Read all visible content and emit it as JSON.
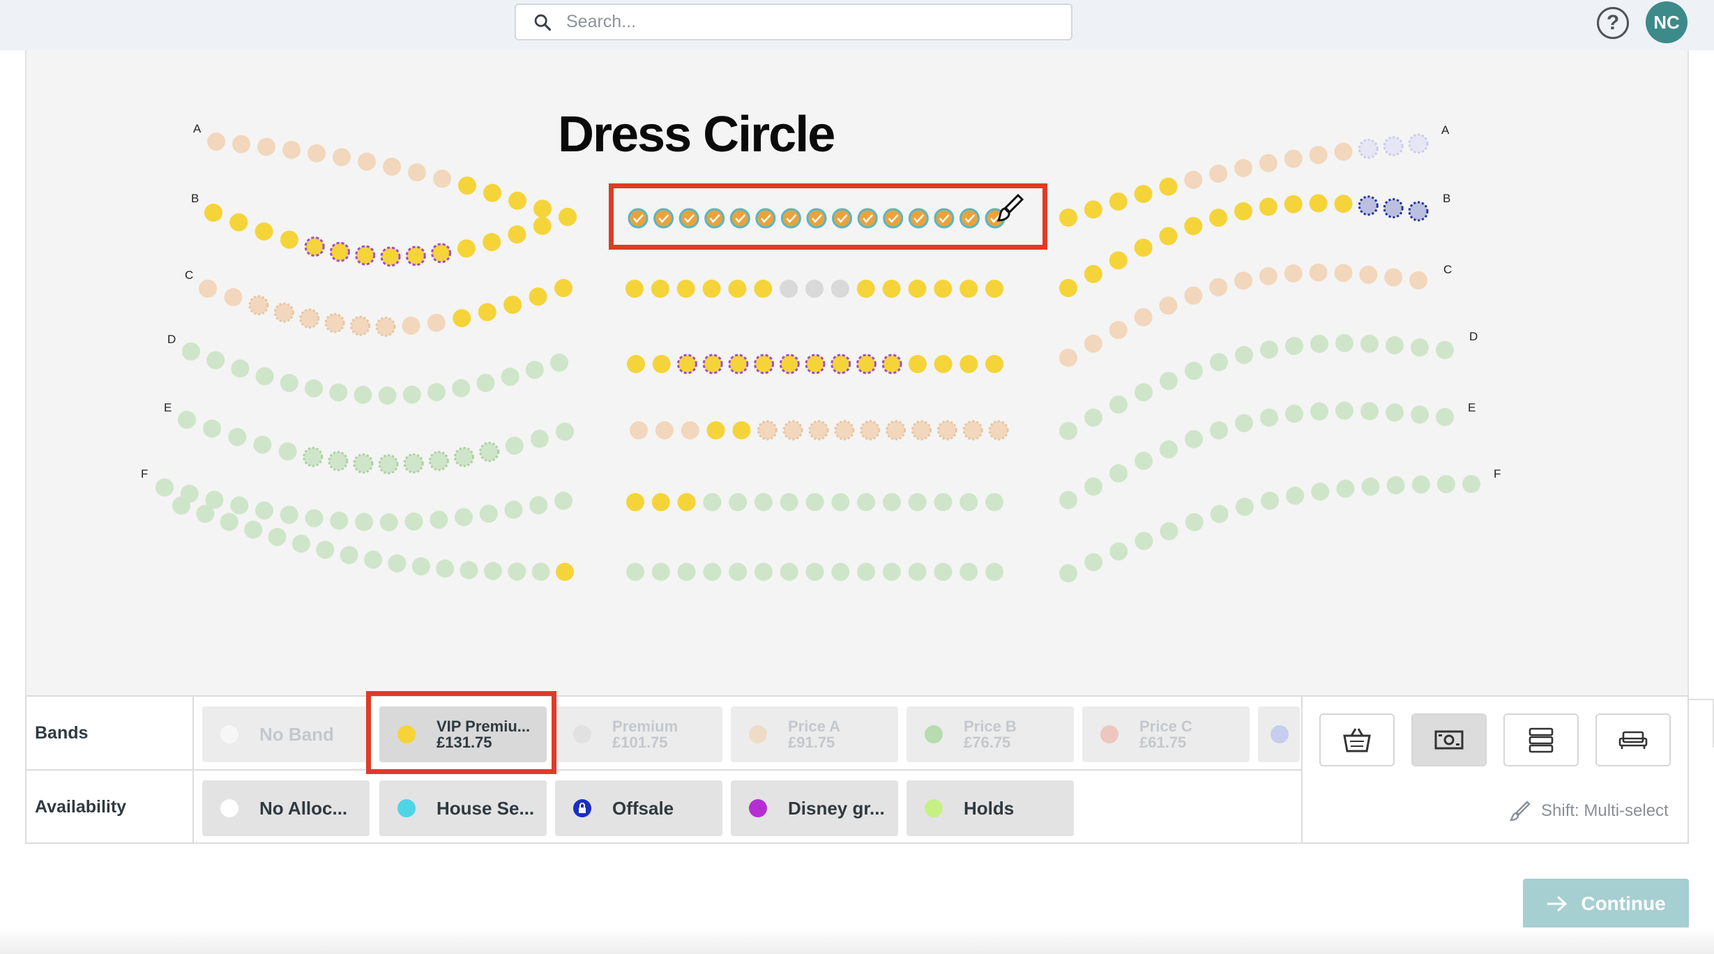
{
  "search": {
    "placeholder": "Search..."
  },
  "header": {
    "help_label": "?",
    "avatar_initials": "NC"
  },
  "seatmap": {
    "section_title": "Dress Circle",
    "row_labels": [
      "A",
      "B",
      "C",
      "D",
      "E",
      "F"
    ],
    "colors": {
      "vip": "#f5d43a",
      "premium": "#d9d9d9",
      "price_a": "#f2d7bc",
      "price_b": "#cfe5c9",
      "selected": "#e8a33d",
      "selected_ring": "#56b7c7",
      "disney_outline": "#a34ad0",
      "offsale_outline": "#1a2fa0"
    }
  },
  "bands_label": "Bands",
  "availability_label": "Availability",
  "bands": [
    {
      "name": "No Band",
      "price": "",
      "color": "#ffffff"
    },
    {
      "name": "VIP Premiu...",
      "price": "£131.75",
      "color": "#f5d43a"
    },
    {
      "name": "Premium",
      "price": "£101.75",
      "color": "#d9d9d9"
    },
    {
      "name": "Price A",
      "price": "£91.75",
      "color": "#f2d0a8"
    },
    {
      "name": "Price B",
      "price": "£76.75",
      "color": "#8ccf7e"
    },
    {
      "name": "Price C",
      "price": "£61.75",
      "color": "#f0a79b"
    }
  ],
  "availability": [
    {
      "name": "No Alloc...",
      "color": "#ffffff"
    },
    {
      "name": "House Se...",
      "color": "#4fd4e6"
    },
    {
      "name": "Offsale",
      "color": "#1a2fc0",
      "icon": "lock-icon"
    },
    {
      "name": "Disney gr...",
      "color": "#b42fd1"
    },
    {
      "name": "Holds",
      "color": "#c6ef84"
    }
  ],
  "tools": [
    "basket-icon",
    "money-icon",
    "server-icon",
    "sofa-icon"
  ],
  "shift_hint": "Shift: Multi-select",
  "continue_label": "Continue"
}
